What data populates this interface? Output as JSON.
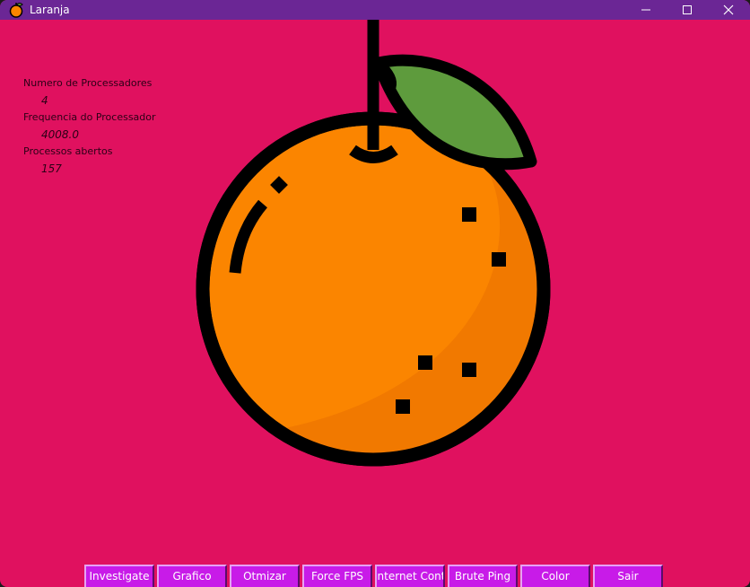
{
  "window": {
    "title": "Laranja"
  },
  "icons": {
    "app": "orange-icon",
    "minimize": "minimize-icon",
    "maximize": "maximize-icon",
    "close": "close-icon",
    "art": "orange-fruit-illustration"
  },
  "colors": {
    "background": "#e0115f",
    "titlebar": "#6b2695",
    "button": "#c81be8",
    "orange": "#fb8500",
    "orange_shade": "#ef7800",
    "leaf": "#5e9b3d",
    "outline": "#000000"
  },
  "info": {
    "cpu_count_label": "Numero de Processadores",
    "cpu_count_value": "4",
    "cpu_freq_label": "Frequencia do Processador",
    "cpu_freq_value": "4008.0",
    "open_processes_label": "Processos abertos",
    "open_processes_value": "157"
  },
  "toolbar": {
    "buttons": [
      {
        "label": "Investigate"
      },
      {
        "label": "Grafico"
      },
      {
        "label": "Otmizar"
      },
      {
        "label": "Force FPS"
      },
      {
        "label": "Internet Control"
      },
      {
        "label": "Brute Ping"
      },
      {
        "label": "Color"
      },
      {
        "label": "Sair"
      }
    ]
  }
}
